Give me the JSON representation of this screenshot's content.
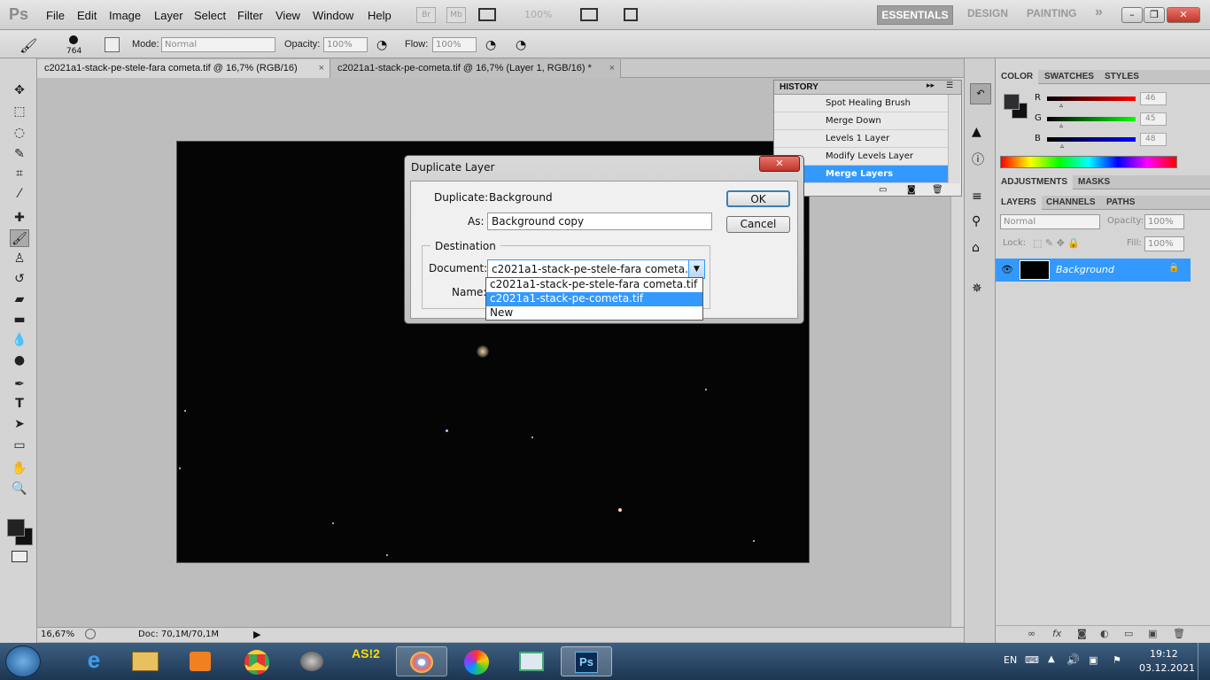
{
  "app": {
    "logo": "Ps"
  },
  "menu": [
    "File",
    "Edit",
    "Image",
    "Layer",
    "Select",
    "Filter",
    "View",
    "Window",
    "Help"
  ],
  "menubar_buttons": {
    "bridge": "Br",
    "minibridge": "Mb",
    "zoom": "100%"
  },
  "workspaces": {
    "essentials": "ESSENTIALS",
    "design": "DESIGN",
    "painting": "PAINTING",
    "more": "»"
  },
  "options": {
    "brush_size": "764",
    "mode_label": "Mode:",
    "mode_value": "Normal",
    "opacity_label": "Opacity:",
    "opacity_value": "100%",
    "flow_label": "Flow:",
    "flow_value": "100%"
  },
  "tabs": [
    {
      "label": "c2021a1-stack-pe-stele-fara cometa.tif @ 16,7% (RGB/16)",
      "close": "×"
    },
    {
      "label": "c2021a1-stack-pe-cometa.tif @ 16,7% (Layer 1, RGB/16) *",
      "close": "×"
    }
  ],
  "status": {
    "zoom": "16,67%",
    "doc": "Doc: 70,1M/70,1M"
  },
  "history": {
    "title": "HISTORY",
    "items": [
      "Spot Healing Brush",
      "Merge Down",
      "Levels 1 Layer",
      "Modify Levels Layer",
      "Merge Layers"
    ],
    "selected_index": 4
  },
  "color_panel": {
    "tabs": [
      "COLOR",
      "SWATCHES",
      "STYLES"
    ],
    "r_label": "R",
    "g_label": "G",
    "b_label": "B",
    "r_value": "46",
    "g_value": "45",
    "b_value": "48",
    "r_level": 0.18,
    "g_level": 0.18,
    "b_level": 0.19
  },
  "adjustments": {
    "tabs": [
      "ADJUSTMENTS",
      "MASKS"
    ]
  },
  "layers": {
    "tabs": [
      "LAYERS",
      "CHANNELS",
      "PATHS"
    ],
    "blend_mode": "Normal",
    "opacity_label": "Opacity:",
    "opacity_value": "100%",
    "lock_label": "Lock:",
    "fill_label": "Fill:",
    "fill_value": "100%",
    "layer_name": "Background"
  },
  "dialog": {
    "title": "Duplicate Layer",
    "duplicate_label": "Duplicate:",
    "duplicate_value": "Background",
    "as_label": "As:",
    "as_value": "Background copy",
    "destination_label": "Destination",
    "document_label": "Document:",
    "document_value": "c2021a1-stack-pe-stele-fara cometa.tif",
    "name_label": "Name:",
    "ok_label": "OK",
    "cancel_label": "Cancel",
    "close_glyph": "✕",
    "options": [
      "c2021a1-stack-pe-stele-fara cometa.tif",
      "c2021a1-stack-pe-cometa.tif",
      "New"
    ],
    "highlighted_index": 1
  },
  "taskbar": {
    "apps": [
      "e",
      "",
      "",
      "",
      "AS!2",
      "",
      "",
      "",
      "Ps"
    ],
    "lang": "EN",
    "time": "19:12",
    "date": "03.12.2021"
  },
  "colors": {
    "accent": "#3399ff",
    "dialog_highlight": "#3399ff",
    "taskbar": "#1c3652"
  }
}
